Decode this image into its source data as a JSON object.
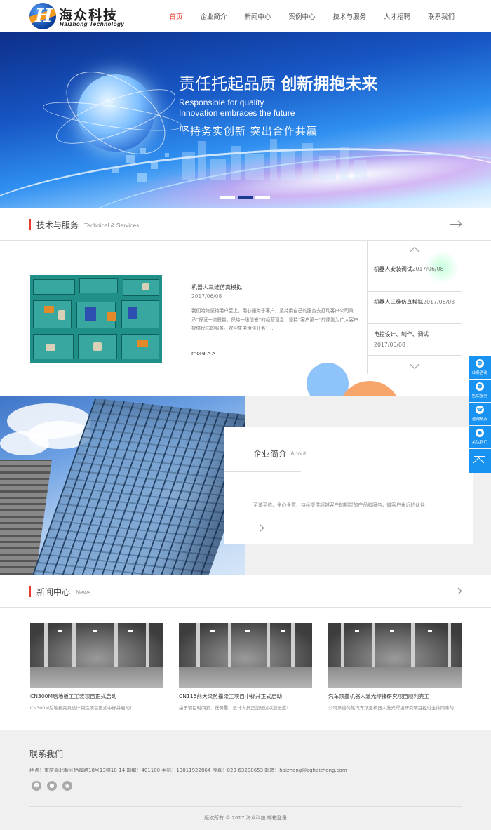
{
  "brand": {
    "name_cn": "海众科技",
    "name_en": "Haizhong Technology",
    "logo_letter": "H",
    "accent": "#e63b2e",
    "float_color": "#1893f2"
  },
  "nav": {
    "items": [
      "首页",
      "企业简介",
      "新闻中心",
      "案例中心",
      "技术与服务",
      "人才招聘",
      "联系我们"
    ],
    "active": "首页"
  },
  "banner": {
    "title_normal": "责任托起品质 ",
    "title_bold": "创新拥抱未来",
    "en_line1": "Responsible for quality",
    "en_line2": "Innovation embraces the future",
    "subtitle": "坚持务实创新  突出合作共赢",
    "slides": 3,
    "active_slide": 2
  },
  "tech": {
    "heading_cn": "技术与服务",
    "heading_en": "Technical & Services",
    "feature": {
      "title": "机器人三维仿真模拟",
      "date": "2017/06/08",
      "desc": "我们始终坚持用户至上，用心服务于客户，坚持用自己的服务去打动客户公司秉承“保证一流质量，保持一级信誉”的经营理念，坚持“客户第一”的原则为广大客户提供优质的服务。欢迎来电洽谈业务！...",
      "more": "more >>"
    },
    "list": [
      {
        "title": "机器人安装调试",
        "date": "2017/06/08"
      },
      {
        "title": "机器人三维仿真模拟",
        "date": "2017/06/08"
      },
      {
        "title": "电控设计、制作、调试",
        "date": "2017/06/08"
      }
    ]
  },
  "about": {
    "heading_cn": "企业简介",
    "heading_en": "About",
    "text": "至诚至信、全心全意、持续提供超越客户的期望的产品和服务，做客户永远的伙伴"
  },
  "news": {
    "heading_cn": "新闻中心",
    "heading_en": "News",
    "items": [
      {
        "title": "CN300M后地板工工装项目正式启动",
        "desc": "CN300M后地板夹具设计制造项目正式中标并启动！"
      },
      {
        "title": "CN115前大梁防撞梁工项目中标并正式启动",
        "desc": "由于项目时间紧、任务重，设计人员正加班加点赶进度！"
      },
      {
        "title": "汽车顶盖机器人激光焊接研究项目顺利完工",
        "desc": "公司承接的某汽车顶盖机器人激光焊接研究项目经过全体同事的..."
      }
    ]
  },
  "contact": {
    "title": "联系我们",
    "info": "地点：重庆渝北新区栖霞路18号13幢10-14 邮编：401100 手机：13811922864 传真：023-63200653 邮箱：haizhong@cqhaizhong.com",
    "social_icons": [
      "qq-icon",
      "wechat-icon",
      "weibo-icon"
    ],
    "copyright": "版权所有 © 2017 海众科技 邮箱登录"
  },
  "float_bar": {
    "items": [
      {
        "label": "业务咨询",
        "icon": "qq-icon"
      },
      {
        "label": "售后服务",
        "icon": "qq-icon"
      },
      {
        "label": "咨询热点",
        "icon": "phone-icon"
      },
      {
        "label": "关注我们",
        "icon": "wechat-icon"
      }
    ]
  }
}
